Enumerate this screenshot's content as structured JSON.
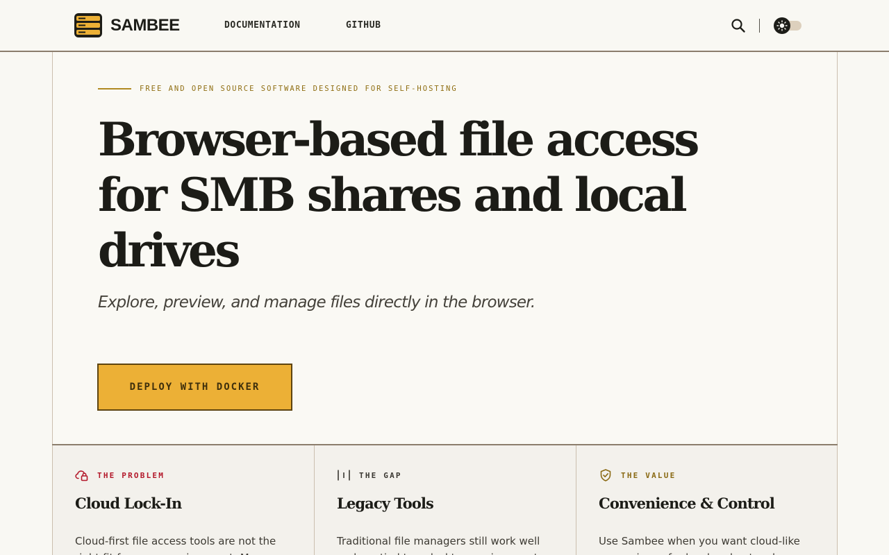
{
  "header": {
    "brand": "SAMBEE",
    "nav": {
      "documentation": "DOCUMENTATION",
      "github": "GITHUB"
    },
    "icons": [
      "menu-logo-icon",
      "search-icon",
      "sun-icon"
    ]
  },
  "hero": {
    "eyebrow": "FREE AND OPEN SOURCE SOFTWARE DESIGNED FOR SELF-HOSTING",
    "title": "Browser-based file access for SMB shares and local drives",
    "subtitle": "Explore, preview, and manage files directly in the browser.",
    "cta": "DEPLOY WITH DOCKER"
  },
  "cards": [
    {
      "tag": "THE PROBLEM",
      "icon": "cloud-lock-icon",
      "title": "Cloud Lock-In",
      "body": "Cloud-first file access tools are not the right fit for every environment. Many"
    },
    {
      "tag": "THE GAP",
      "icon": "gap-icon",
      "title": "Legacy Tools",
      "body": "Traditional file managers still work well and are tied to a desktop environment."
    },
    {
      "tag": "THE VALUE",
      "icon": "shield-check-icon",
      "title": "Convenience & Control",
      "body": "Use Sambee when you want cloud-like convenience for local and network"
    }
  ],
  "colors": {
    "accent": "#ecb036",
    "problem": "#b3182a",
    "value": "#8a6a14",
    "background": "#f9f8f3"
  }
}
